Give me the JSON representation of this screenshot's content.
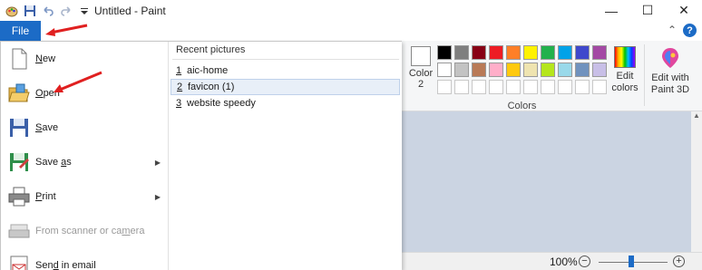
{
  "window": {
    "title": "Untitled - Paint",
    "controls": {
      "minimize": "—",
      "maximize": "☐",
      "close": "✕"
    }
  },
  "ribbon": {
    "file_tab": "File",
    "color2_label": "Color\n2",
    "color2_line1": "Color",
    "color2_line2": "2",
    "colors_group_label": "Colors",
    "edit_colors_line1": "Edit",
    "edit_colors_line2": "colors",
    "edit3d_line1": "Edit with",
    "edit3d_line2": "Paint 3D",
    "palette_row1": [
      "#000000",
      "#7f7f7f",
      "#880015",
      "#ed1c24",
      "#ff7f27",
      "#fff200",
      "#22b14c",
      "#00a2e8",
      "#3f48cc",
      "#a349a4"
    ],
    "palette_row2": [
      "#ffffff",
      "#c3c3c3",
      "#b97a57",
      "#ffaec9",
      "#ffc90e",
      "#efe4b0",
      "#b5e61d",
      "#99d9ea",
      "#7092be",
      "#c8bfe7"
    ],
    "palette_row3": [
      "#ffffff",
      "#ffffff",
      "#ffffff",
      "#ffffff",
      "#ffffff",
      "#ffffff",
      "#ffffff",
      "#ffffff",
      "#ffffff",
      "#ffffff"
    ]
  },
  "file_menu": {
    "items": [
      {
        "label": "New",
        "accel": "N",
        "icon": "new-document-icon",
        "enabled": true,
        "submenu": false
      },
      {
        "label": "Open",
        "accel": "O",
        "icon": "open-folder-icon",
        "enabled": true,
        "submenu": false
      },
      {
        "label": "Save",
        "accel": "S",
        "icon": "save-disk-icon",
        "enabled": true,
        "submenu": false
      },
      {
        "label": "Save as",
        "accel": "a",
        "icon": "save-as-icon",
        "enabled": true,
        "submenu": true
      },
      {
        "label": "Print",
        "accel": "P",
        "icon": "printer-icon",
        "enabled": true,
        "submenu": true
      },
      {
        "label": "From scanner or camera",
        "accel": "m",
        "icon": "scanner-icon",
        "enabled": false,
        "submenu": false
      },
      {
        "label": "Send in email",
        "accel": "d",
        "icon": "email-icon",
        "enabled": true,
        "submenu": false
      }
    ],
    "recent_title": "Recent pictures",
    "recent": [
      {
        "num": "1",
        "name": "aic-home",
        "selected": false
      },
      {
        "num": "2",
        "name": "favicon (1)",
        "selected": true
      },
      {
        "num": "3",
        "name": "website speedy",
        "selected": false
      }
    ]
  },
  "status": {
    "zoom": "100%",
    "zoom_out": "−",
    "zoom_in": "+",
    "zoom_level": 0.5
  },
  "colors": {
    "accent": "#1c6bc6",
    "annotation": "#e02020",
    "canvas_bg": "#cbd4e2"
  }
}
